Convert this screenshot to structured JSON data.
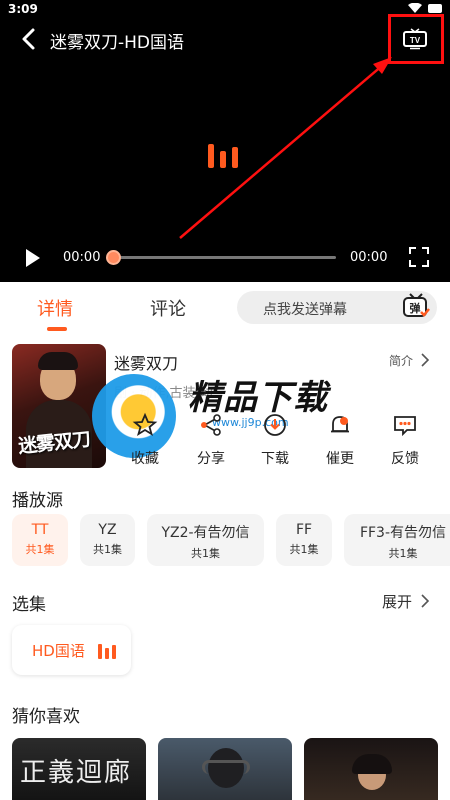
{
  "status_bar": {
    "time": "3:09"
  },
  "player": {
    "title": "迷雾双刀-HD国语",
    "time_current": "00:00",
    "time_total": "00:00",
    "progress": 0
  },
  "tabs": [
    {
      "label": "详情",
      "active": true
    },
    {
      "label": "评论",
      "active": false
    }
  ],
  "danmaku": {
    "placeholder": "点我发送弹幕",
    "icon_label": "弹"
  },
  "movie": {
    "name": "迷雾双刀",
    "intro_link": "简介",
    "tags_partial": "剧 · 动作,古装,动"
  },
  "watermark": {
    "text": "精品下载",
    "url": "www.jj9p.com"
  },
  "actions": [
    {
      "label": "收藏",
      "icon": "star-icon"
    },
    {
      "label": "分享",
      "icon": "share-icon"
    },
    {
      "label": "下载",
      "icon": "download-icon"
    },
    {
      "label": "催更",
      "icon": "bell-icon"
    },
    {
      "label": "反馈",
      "icon": "feedback-icon"
    }
  ],
  "sources": {
    "title": "播放源",
    "items": [
      {
        "name": "TT",
        "count": "共1集",
        "active": true
      },
      {
        "name": "YZ",
        "count": "共1集",
        "active": false
      },
      {
        "name": "YZ2-有告勿信",
        "count": "共1集",
        "active": false
      },
      {
        "name": "FF",
        "count": "共1集",
        "active": false
      },
      {
        "name": "FF3-有告勿信",
        "count": "共1集",
        "active": false
      }
    ]
  },
  "episodes": {
    "title": "选集",
    "expand_label": "展开",
    "items": [
      {
        "label": "HD国语",
        "playing": true
      }
    ]
  },
  "recommendations": {
    "title": "猜你喜欢",
    "items": [
      {
        "poster_text": "正義迴廊"
      },
      {
        "poster_text": ""
      },
      {
        "poster_text": ""
      }
    ]
  },
  "colors": {
    "accent": "#ff5a1f",
    "highlight_red": "#ff1010",
    "player_bg": "#000000",
    "page_bg": "#f5f5f5"
  }
}
